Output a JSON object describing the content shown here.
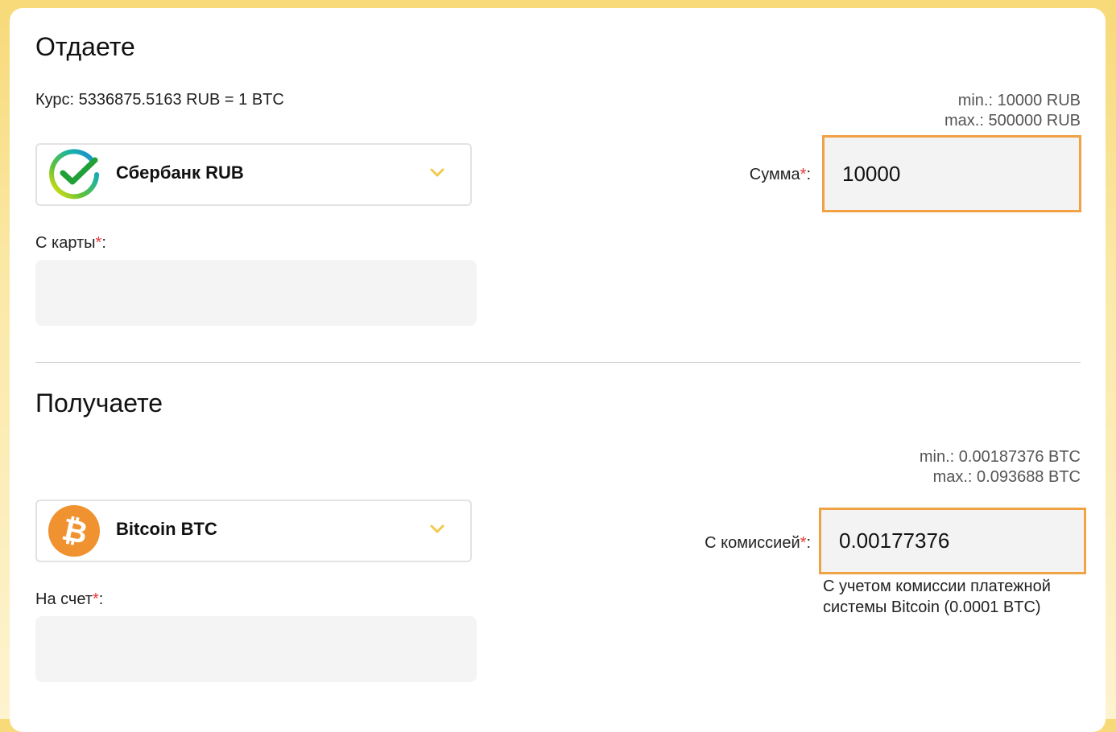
{
  "give": {
    "title": "Отдаете",
    "rate": "Курс: 5336875.5163 RUB = 1 BTC",
    "min": "min.: 10000 RUB",
    "max": "max.: 500000 RUB",
    "currency": {
      "name": "Сбербанк RUB",
      "icon": "sberbank-logo-icon"
    },
    "amount_label": "Сумма",
    "amount_value": "10000",
    "card_label": "С карты",
    "card_value": ""
  },
  "receive": {
    "title": "Получаете",
    "min": "min.: 0.00187376 BTC",
    "max": "max.: 0.093688 BTC",
    "currency": {
      "name": "Bitcoin BTC",
      "icon": "bitcoin-logo-icon"
    },
    "amount_label": "С комиссией",
    "amount_value": "0.00177376",
    "fee_note": "С учетом комиссии платежной системы Bitcoin (0.0001 BTC)",
    "account_label": "На счет",
    "account_value": ""
  },
  "required_mark": "*",
  "colon": ":",
  "colors": {
    "highlight_border": "#f0a245",
    "required": "#e53935",
    "chevron": "#f2c94c",
    "bitcoin": "#f0922f"
  }
}
